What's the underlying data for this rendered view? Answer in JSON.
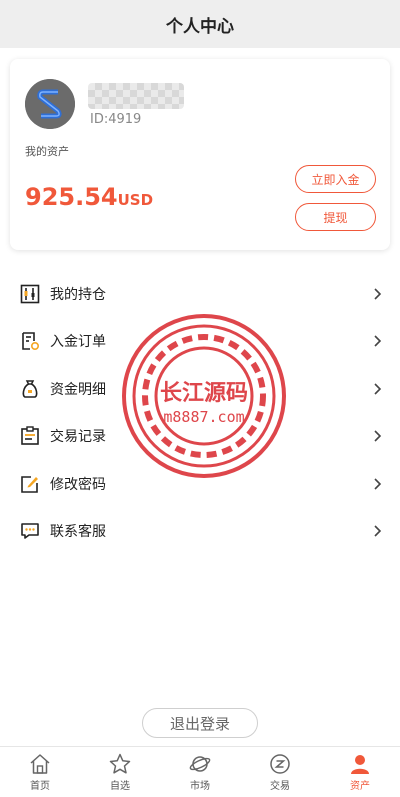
{
  "header": {
    "title": "个人中心"
  },
  "profile": {
    "id_text": "ID:4919"
  },
  "assets": {
    "label": "我的资产",
    "amount": "925.54",
    "currency": "USD",
    "deposit_label": "立即入金",
    "withdraw_label": "提现"
  },
  "menu": [
    {
      "label": "我的持仓",
      "icon": "holdings-icon"
    },
    {
      "label": "入金订单",
      "icon": "deposit-order-icon"
    },
    {
      "label": "资金明细",
      "icon": "money-bag-icon"
    },
    {
      "label": "交易记录",
      "icon": "trade-record-icon"
    },
    {
      "label": "修改密码",
      "icon": "edit-password-icon"
    },
    {
      "label": "联系客服",
      "icon": "customer-service-icon"
    }
  ],
  "watermark": {
    "line1": "长江源码",
    "line2": "m8887.com"
  },
  "logout_label": "退出登录",
  "tabs": [
    {
      "label": "首页",
      "icon": "home-icon"
    },
    {
      "label": "自选",
      "icon": "star-icon"
    },
    {
      "label": "市场",
      "icon": "planet-icon"
    },
    {
      "label": "交易",
      "icon": "exchange-icon"
    },
    {
      "label": "资产",
      "icon": "user-icon",
      "active": true
    }
  ],
  "colors": {
    "accent": "#f0583a",
    "icon_orange": "#f5a623",
    "watermark_red": "#d9262c"
  }
}
